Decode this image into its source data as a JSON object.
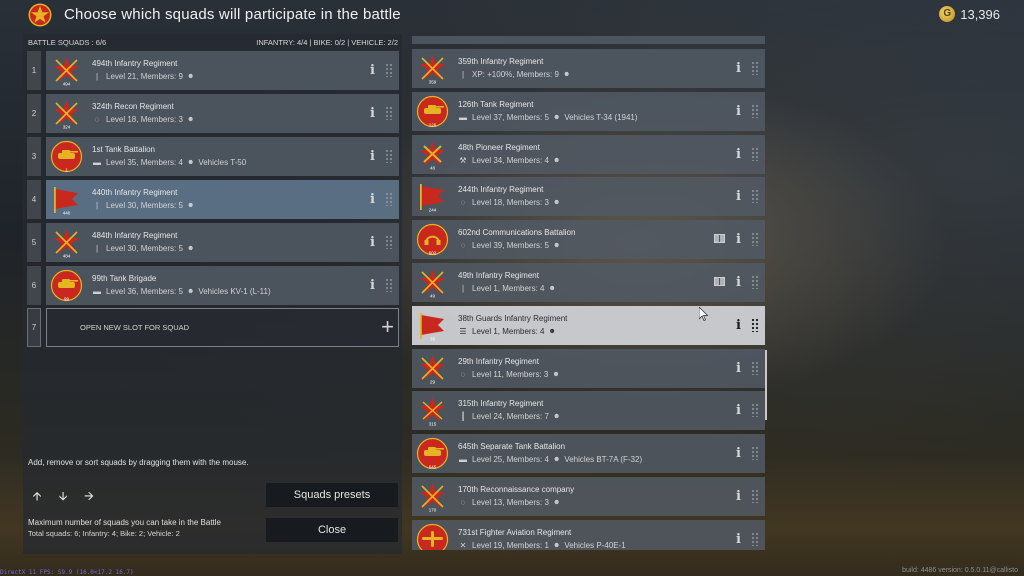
{
  "header": {
    "title": "Choose which squads will participate in the battle",
    "currency": "13,396"
  },
  "battle": {
    "label": "BATTLE SQUADS : 6/6",
    "stats": "INFANTRY: 4/4 | BIKE: 0/2 | VEHICLE: 2/2"
  },
  "slots": [
    {
      "num": "1",
      "name": "494th Infantry Regiment",
      "icon": "infantry-icon",
      "info": "Level 21, Members: 9",
      "badge": "494",
      "emblem_type": "rifles"
    },
    {
      "num": "2",
      "name": "324th Recon Regiment",
      "icon": "recon-icon",
      "info": "Level 18, Members: 3",
      "badge": "324",
      "emblem_type": "rifles"
    },
    {
      "num": "3",
      "name": "1st Tank Battalion",
      "icon": "tank-icon",
      "info": "Level 35, Members: 4",
      "extra": "Vehicles T-50",
      "badge": "1",
      "emblem_type": "tank"
    },
    {
      "num": "4",
      "name": "440th Infantry Regiment",
      "icon": "infantry-icon",
      "info": "Level 30, Members: 5",
      "badge": "440",
      "emblem_type": "flag"
    },
    {
      "num": "5",
      "name": "484th Infantry Regiment",
      "icon": "infantry-icon",
      "info": "Level 30, Members: 5",
      "badge": "484",
      "emblem_type": "rifles"
    },
    {
      "num": "6",
      "name": "99th Tank Brigade",
      "icon": "tank-icon",
      "info": "Level 36, Members: 5",
      "extra": "Vehicles KV-1 (L-11)",
      "badge": "99",
      "emblem_type": "tank"
    }
  ],
  "new_slot": {
    "num": "7",
    "label": "OPEN NEW SLOT FOR SQUAD"
  },
  "hint": "Add, remove or sort squads by dragging them with the mouse.",
  "max_label": "Maximum number of squads you can take in the Battle",
  "totals": "Total squads: 6; Infantry: 4; Bike: 2; Vehicle: 2",
  "buttons": {
    "presets": "Squads presets",
    "close": "Close"
  },
  "reserve": [
    {
      "name": "359th Infantry Regiment",
      "icon": "infantry-icon",
      "info": "XP: +100%, Members: 9",
      "badge": "359",
      "emblem_type": "rifles"
    },
    {
      "name": "126th Tank Regiment",
      "icon": "tank-icon",
      "info": "Level 37, Members: 5",
      "extra": "Vehicles T-34 (1941)",
      "badge": "126",
      "emblem_type": "tank"
    },
    {
      "name": "48th Pioneer Regiment",
      "icon": "wrench-icon",
      "info": "Level 34, Members: 4",
      "badge": "48",
      "emblem_type": "tools"
    },
    {
      "name": "244th Infantry Regiment",
      "icon": "recon-icon",
      "info": "Level 18, Members: 3",
      "badge": "244",
      "emblem_type": "flag"
    },
    {
      "name": "602nd Communications Battalion",
      "icon": "radio-icon",
      "info": "Level 39, Members: 5",
      "badge": "602",
      "emblem_type": "radio",
      "book": true
    },
    {
      "name": "49th Infantry Regiment",
      "icon": "infantry-icon",
      "info": "Level 1, Members: 4",
      "badge": "49",
      "emblem_type": "rifles",
      "book": true
    },
    {
      "name": "38th Guards Infantry Regiment",
      "icon": "list-icon",
      "info": "Level 1, Members: 4",
      "badge": "38",
      "emblem_type": "flag",
      "selected": true
    },
    {
      "name": "29th Infantry Regiment",
      "icon": "recon-icon",
      "info": "Level 11, Members: 3",
      "badge": "29",
      "emblem_type": "rifles"
    },
    {
      "name": "315th Infantry Regiment",
      "icon": "mg-icon",
      "info": "Level 24, Members: 7",
      "badge": "315",
      "emblem_type": "star"
    },
    {
      "name": "645th Separate Tank Battalion",
      "icon": "tank-icon",
      "info": "Level 25, Members: 4",
      "extra": "Vehicles BT-7A (F-32)",
      "badge": "645",
      "emblem_type": "tank"
    },
    {
      "name": "170th Reconnaissance company",
      "icon": "recon-icon",
      "info": "Level 13, Members: 3",
      "badge": "170",
      "emblem_type": "rifles"
    },
    {
      "name": "731st Fighter Aviation Regiment",
      "icon": "plane-icon",
      "info": "Level 19, Members: 1",
      "extra": "Vehicles P-40E-1",
      "badge": "731",
      "emblem_type": "plane"
    }
  ],
  "footer": {
    "left": "DirectX 11 FPS: 59.9 (16.0<17.2 16.7)",
    "right": "build: 4486 version: 0.5.0.11@callisto"
  },
  "colors": {
    "accent_red": "#c8281e",
    "gold": "#e6b422",
    "highlight": "#5f768c"
  }
}
